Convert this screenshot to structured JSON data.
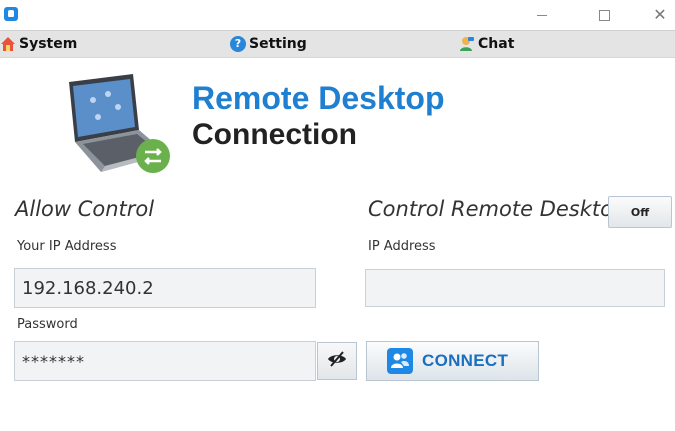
{
  "window": {
    "app_icon": "remote-desktop-app-icon",
    "minimize_symbol": "–",
    "maximize_symbol": "□",
    "close_symbol": "✕"
  },
  "menu": {
    "items": [
      {
        "label": "System",
        "icon": "home-icon"
      },
      {
        "label": "Setting",
        "icon": "help-icon"
      },
      {
        "label": "Chat",
        "icon": "chat-user-icon"
      }
    ]
  },
  "header": {
    "title_line1": "Remote Desktop",
    "title_line2": "Connection",
    "logo_icon": "laptop-transfer-icon"
  },
  "allow_control": {
    "title": "Allow Control",
    "ip_label": "Your IP Address",
    "ip_value": "192.168.240.2",
    "password_label": "Password",
    "password_value": "*******",
    "eye_icon": "eye-slash-icon"
  },
  "control_remote": {
    "title": "Control Remote Desktop",
    "toggle_label": "Off",
    "ip_label": "IP Address",
    "ip_value": "",
    "connect_label": "CONNECT",
    "connect_icon": "users-icon"
  },
  "colors": {
    "accent": "#1f7fd0",
    "menubar_bg": "#e4e4e4",
    "field_bg": "#f2f3f4",
    "badge_green": "#6ab04c"
  }
}
